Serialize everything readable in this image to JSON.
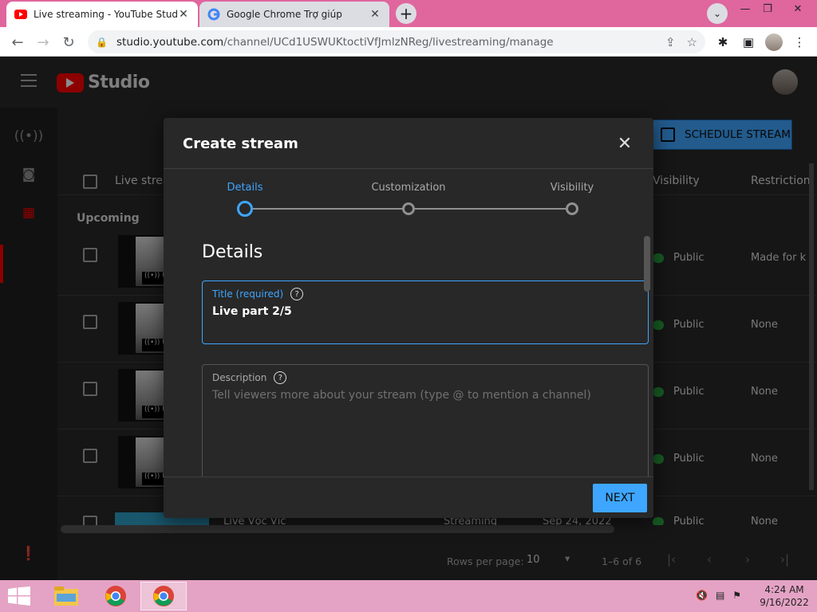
{
  "browser": {
    "tabs": [
      {
        "title": "Live streaming - YouTube Studio",
        "icon": "youtube-icon",
        "active": true
      },
      {
        "title": "Google Chrome Trợ giúp",
        "icon": "google-icon",
        "active": false
      }
    ],
    "new_tab": "+",
    "url_host": "studio.youtube.com",
    "url_path": "/channel/UCd1USWUKtoctiVfJmlzNReg/livestreaming/manage"
  },
  "studio": {
    "logo_text": "Studio",
    "schedule_button": "SCHEDULE STREAM",
    "table": {
      "col_live": "Live strea",
      "col_visibility": "Visibility",
      "col_restrictions": "Restriction",
      "section": "Upcoming",
      "rows": [
        {
          "visibility": "Public",
          "restriction": "Made for ki"
        },
        {
          "visibility": "Public",
          "restriction": "None"
        },
        {
          "visibility": "Public",
          "restriction": "None"
        },
        {
          "visibility": "Public",
          "restriction": "None"
        },
        {
          "title": "Live Vọc Vịc",
          "status": "Streaming",
          "date": "Sep 24, 2022",
          "visibility": "Public",
          "restriction": "None"
        }
      ]
    },
    "pagination": {
      "rows_label": "Rows per page:",
      "rows_value": "10",
      "range": "1–6 of 6"
    }
  },
  "dialog": {
    "title": "Create stream",
    "steps": [
      "Details",
      "Customization",
      "Visibility"
    ],
    "active_step": 0,
    "section_title": "Details",
    "title_field": {
      "label": "Title (required)",
      "value": "Live part 2/5"
    },
    "description_field": {
      "label": "Description",
      "placeholder": "Tell viewers more about your stream (type @ to mention a channel)"
    },
    "next_button": "NEXT"
  },
  "taskbar": {
    "time": "4:24 AM",
    "date": "9/16/2022"
  },
  "colors": {
    "accent": "#3ea6ff",
    "brand_red": "#ff0000",
    "public_green": "#2ba640",
    "tab_strip": "#e0669e",
    "taskbar": "#e4a3c4"
  }
}
